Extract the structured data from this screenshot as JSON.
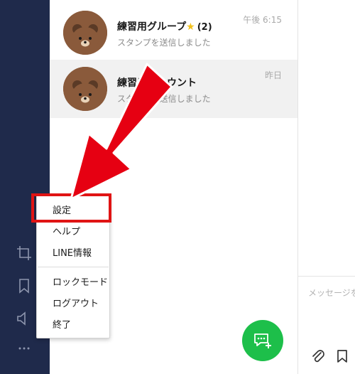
{
  "chats": [
    {
      "name": "練習用グループ",
      "star": "★",
      "count": "(2)",
      "preview": "スタンプを送信しました",
      "time": "午後 6:15",
      "selected": false
    },
    {
      "name": "練習用アカウント",
      "preview": "スタンプを送信しました",
      "time": "昨日",
      "selected": true
    }
  ],
  "menu": {
    "items": [
      "設定",
      "ヘルプ",
      "LINE情報",
      "ロックモード",
      "ログアウト",
      "終了"
    ],
    "highlighted": "設定"
  },
  "composer": {
    "placeholder": "メッセージを"
  },
  "rail": {
    "icons": [
      "crop-icon",
      "bookmark-icon",
      "speaker-icon",
      "more-icon"
    ]
  },
  "colors": {
    "rail": "#1f2a4b",
    "accent_green": "#1dbf4a",
    "highlight_red": "#e01414",
    "selected_row": "#f1f1f1"
  }
}
